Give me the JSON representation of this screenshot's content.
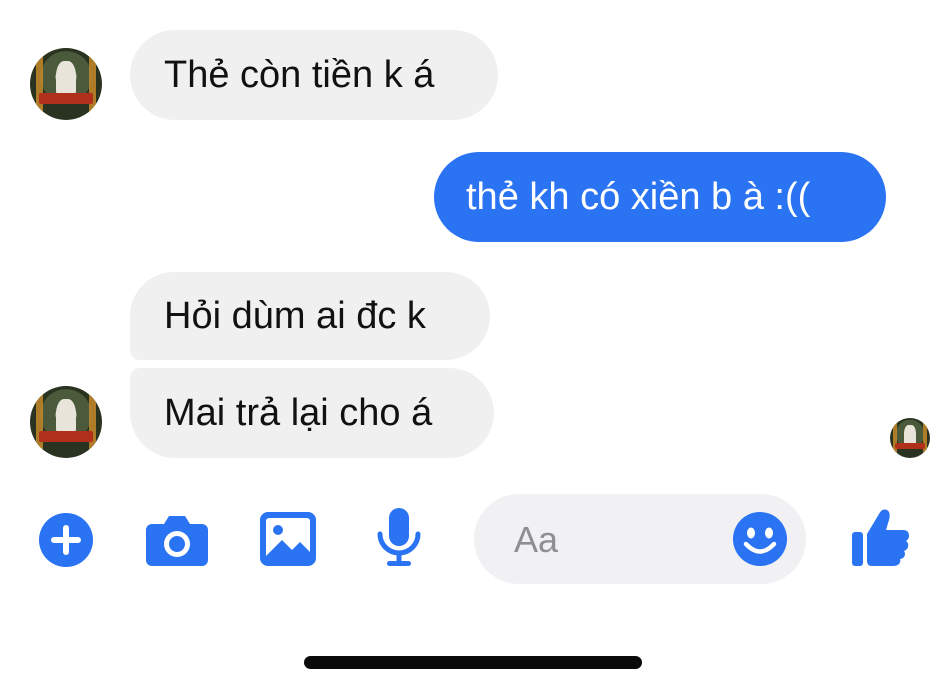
{
  "messages": [
    {
      "direction": "incoming",
      "text": "Thẻ còn tiền k á"
    },
    {
      "direction": "outgoing",
      "text": "thẻ kh có xiền b à :(("
    },
    {
      "direction": "incoming",
      "text": "Hỏi dùm ai đc k"
    },
    {
      "direction": "incoming",
      "text": "Mai trả lại cho á"
    }
  ],
  "composer": {
    "placeholder": "Aa",
    "icons": [
      "plus-icon",
      "camera-icon",
      "image-icon",
      "microphone-icon",
      "emoji-icon",
      "thumbs-up-icon"
    ]
  },
  "colors": {
    "accent": "#2a73f3",
    "incoming_bubble": "#f0f0f0",
    "outgoing_text": "#ffffff"
  }
}
